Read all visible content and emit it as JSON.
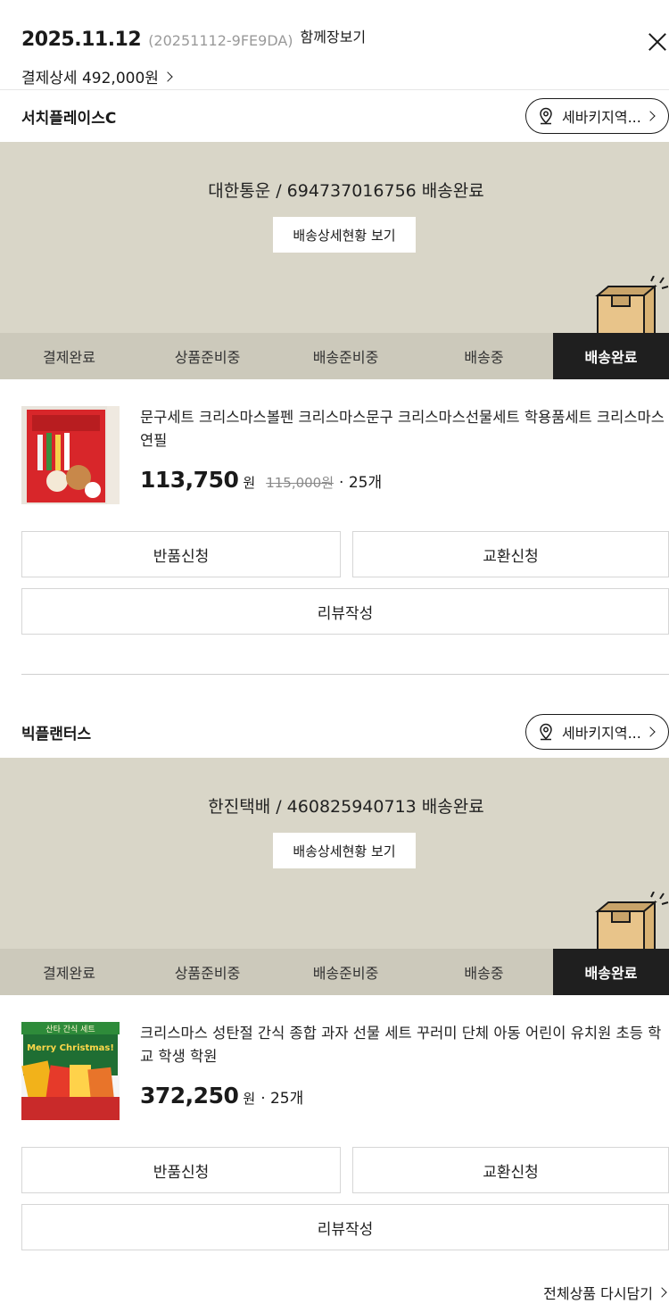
{
  "header": {
    "order_date": "2025.11.12",
    "order_no": "(20251112-9FE9DA)",
    "share_label": "함께장보기",
    "pay_detail_label": "결제상세 492,000원"
  },
  "shipments": [
    {
      "seller": "서치플레이스C",
      "region_label": "세바키지역...",
      "tracking_text": "대한통운 / 694737016756 배송완료",
      "tracking_button": "배송상세현황 보기",
      "steps": [
        "결제완료",
        "상품준비중",
        "배송준비중",
        "배송중",
        "배송완료"
      ],
      "active_step": "배송완료",
      "product": {
        "name": "문구세트 크리스마스볼펜 크리스마스문구 크리스마스선물세트 학용품세트 크리스마스연필",
        "price": "113,750",
        "won": "원",
        "original_price": "115,000원",
        "qty": "· 25개"
      },
      "actions": {
        "return": "반품신청",
        "exchange": "교환신청",
        "review": "리뷰작성"
      }
    },
    {
      "seller": "빅플랜터스",
      "region_label": "세바키지역...",
      "tracking_text": "한진택배 / 460825940713 배송완료",
      "tracking_button": "배송상세현황 보기",
      "steps": [
        "결제완료",
        "상품준비중",
        "배송준비중",
        "배송중",
        "배송완료"
      ],
      "active_step": "배송완료",
      "product": {
        "name": "크리스마스 성탄절 간식 종합 과자 선물 세트 꾸러미 단체 아동 어린이 유치원 초등 학교 학생 학원",
        "price": "372,250",
        "won": "원",
        "qty": "· 25개",
        "thumb_banner": "산타 간식 세트",
        "thumb_text": "Merry Christmas!"
      },
      "actions": {
        "return": "반품신청",
        "exchange": "교환신청",
        "review": "리뷰작성"
      }
    }
  ],
  "footer": {
    "reorder_label": "전체상품 다시담기"
  },
  "colors": {
    "tracking_bg": "#d9d6c8",
    "steps_bg": "#ccc9bb",
    "active_step": "#1f1f1f",
    "box": "#e8c48a"
  }
}
